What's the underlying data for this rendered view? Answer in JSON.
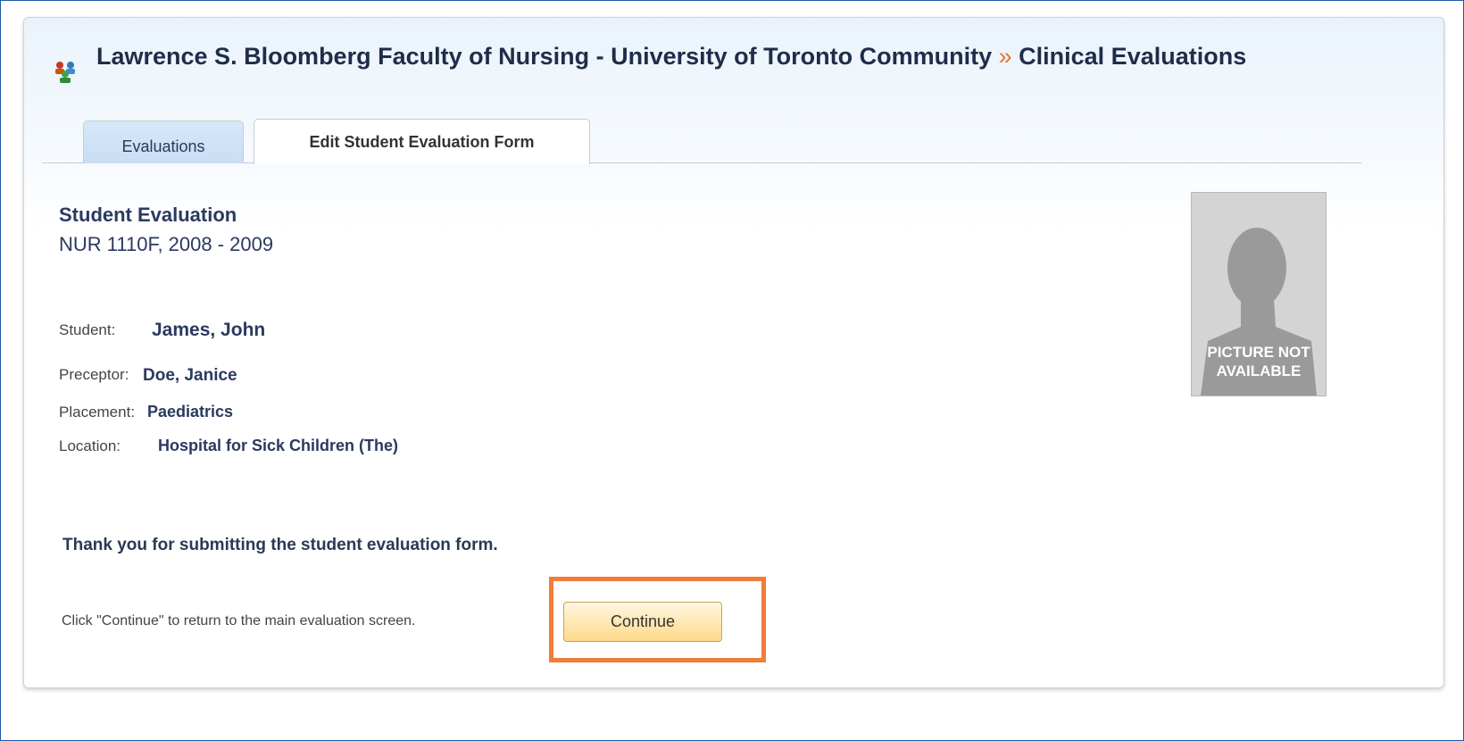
{
  "header": {
    "title_main": "Lawrence S. Bloomberg Faculty of Nursing - University of Toronto Community",
    "separator": "»",
    "title_section": "Clinical Evaluations",
    "icon": "users-group-icon"
  },
  "tabs": [
    {
      "label": "Evaluations",
      "active": false
    },
    {
      "label": "Edit Student Evaluation Form",
      "active": true
    }
  ],
  "evaluation": {
    "title": "Student Evaluation",
    "course": "NUR 1110F, 2008 - 2009"
  },
  "fields": {
    "student": {
      "label": "Student:",
      "value": "James, John"
    },
    "preceptor": {
      "label": "Preceptor:",
      "value": "Doe, Janice"
    },
    "placement": {
      "label": "Placement:",
      "value": "Paediatrics"
    },
    "location": {
      "label": "Location:",
      "value": "Hospital for Sick Children (The)"
    }
  },
  "photo": {
    "line1": "PICTURE NOT",
    "line2": "AVAILABLE",
    "icon": "person-silhouette-icon"
  },
  "message": {
    "thanks": "Thank you for submitting the student evaluation form.",
    "instruction": "Click \"Continue\" to return to the main evaluation screen."
  },
  "actions": {
    "continue_label": "Continue"
  },
  "colors": {
    "accent_orange": "#f27c38",
    "title_text": "#1f2d4a",
    "frame_blue": "#1e5aa8"
  }
}
